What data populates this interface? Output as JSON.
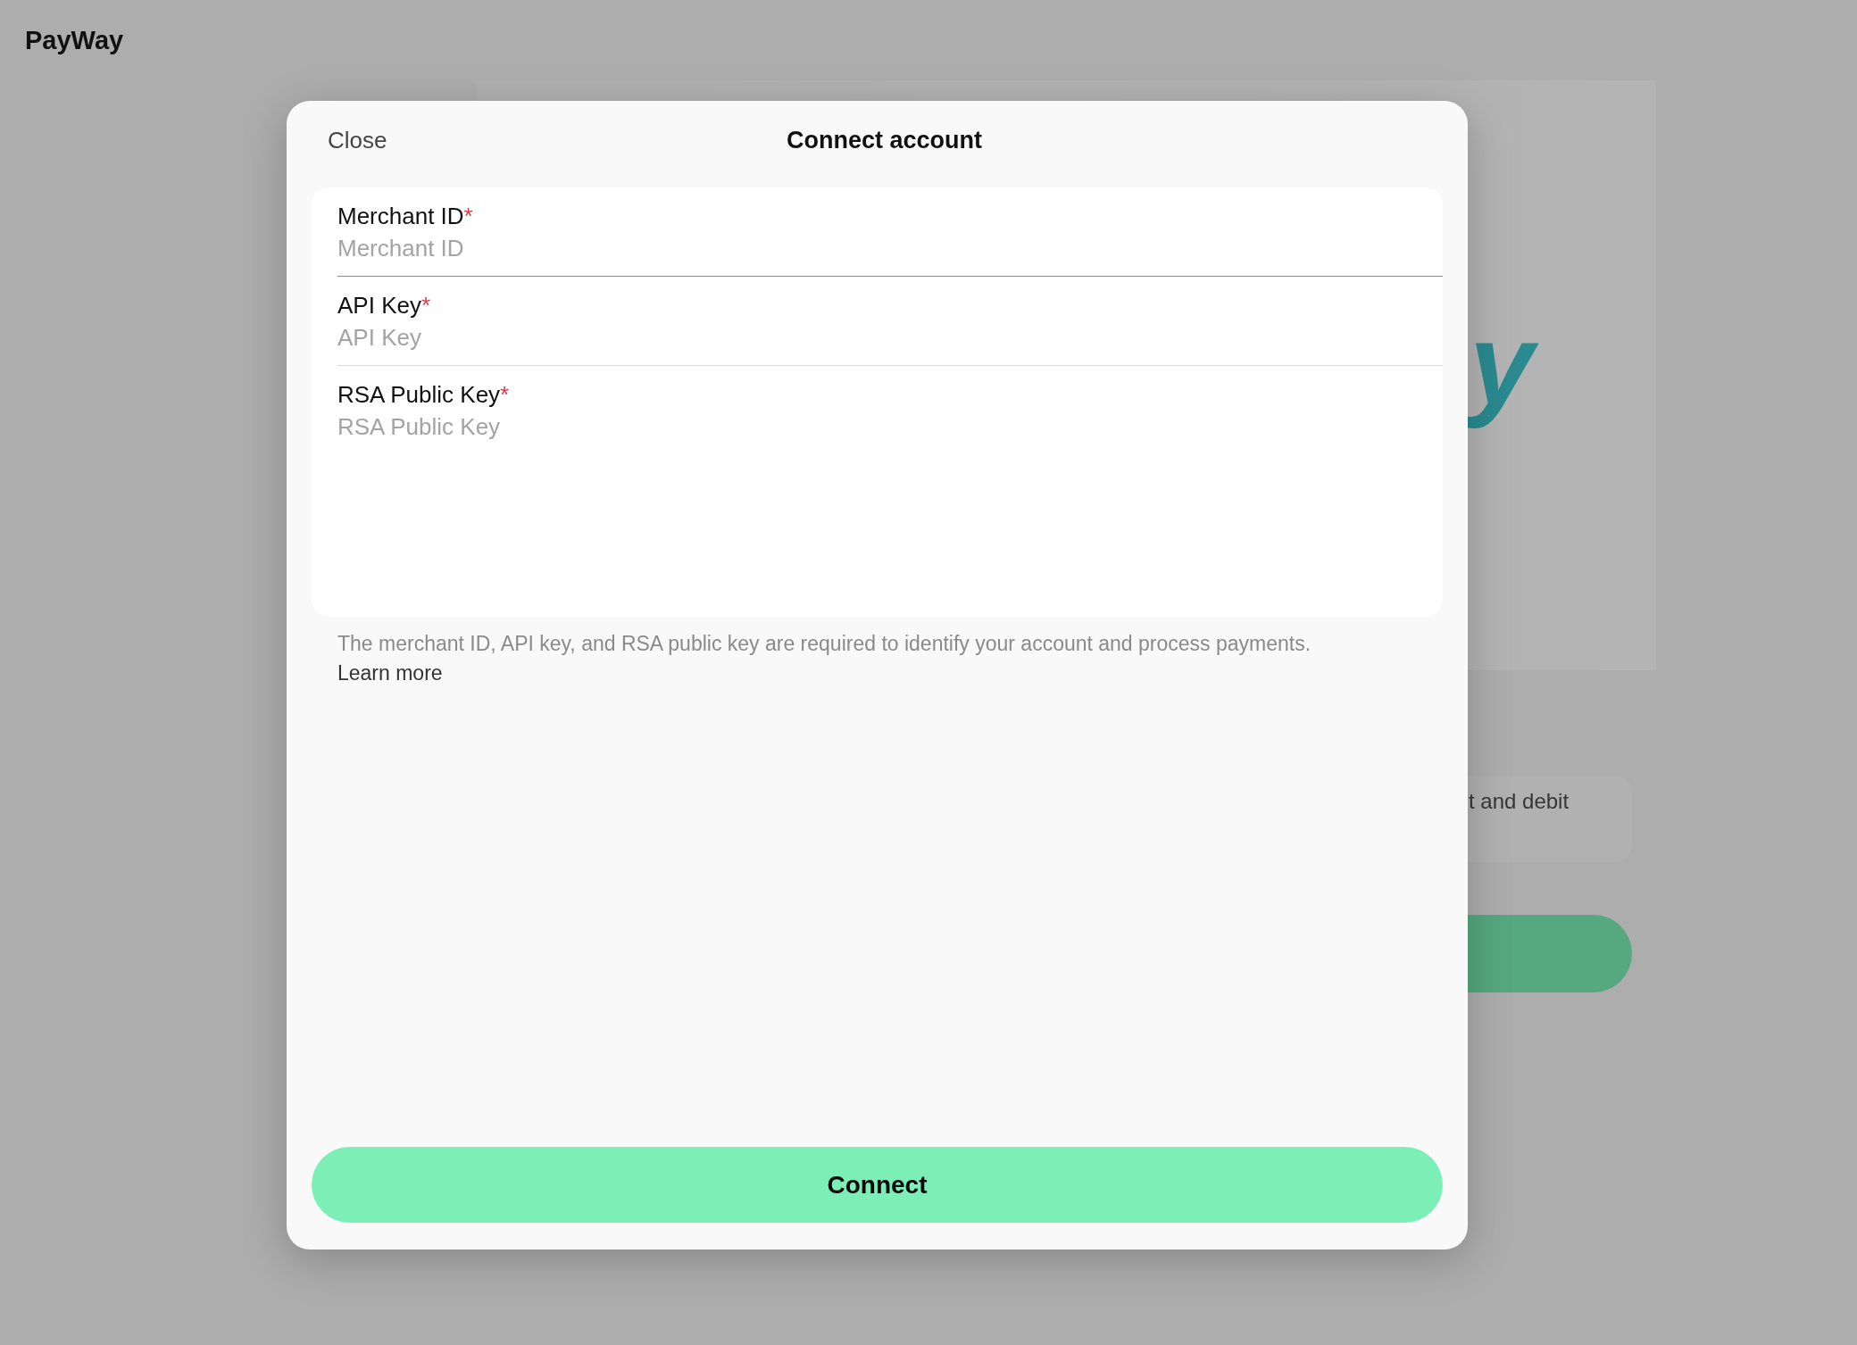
{
  "app": {
    "name": "PayWay"
  },
  "background": {
    "logo_text": "y",
    "card_text": "t and debit"
  },
  "modal": {
    "close_label": "Close",
    "title": "Connect account",
    "fields": [
      {
        "kind": "input",
        "label": "Merchant ID",
        "required_mark": "*",
        "placeholder": "Merchant ID",
        "focused": true
      },
      {
        "kind": "input",
        "label": "API Key",
        "required_mark": "*",
        "placeholder": "API Key",
        "focused": false
      },
      {
        "kind": "textarea",
        "label": "RSA Public Key",
        "required_mark": "*",
        "placeholder": "RSA Public Key",
        "focused": false
      }
    ],
    "helper": {
      "text": "The merchant ID, API key, and RSA public key are required to identify your account and process payments.",
      "link": "Learn more"
    },
    "submit_label": "Connect"
  }
}
